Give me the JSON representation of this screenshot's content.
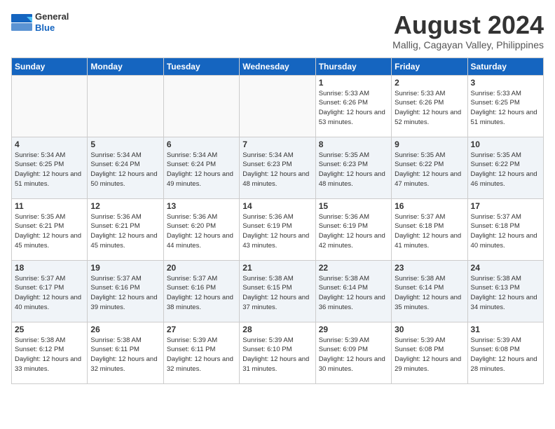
{
  "header": {
    "logo_line1": "General",
    "logo_line2": "Blue",
    "month_year": "August 2024",
    "location": "Mallig, Cagayan Valley, Philippines"
  },
  "weekdays": [
    "Sunday",
    "Monday",
    "Tuesday",
    "Wednesday",
    "Thursday",
    "Friday",
    "Saturday"
  ],
  "weeks": [
    [
      {
        "day": "",
        "info": ""
      },
      {
        "day": "",
        "info": ""
      },
      {
        "day": "",
        "info": ""
      },
      {
        "day": "",
        "info": ""
      },
      {
        "day": "1",
        "sunrise": "5:33 AM",
        "sunset": "6:26 PM",
        "daylight": "12 hours and 53 minutes."
      },
      {
        "day": "2",
        "sunrise": "5:33 AM",
        "sunset": "6:26 PM",
        "daylight": "12 hours and 52 minutes."
      },
      {
        "day": "3",
        "sunrise": "5:33 AM",
        "sunset": "6:25 PM",
        "daylight": "12 hours and 51 minutes."
      }
    ],
    [
      {
        "day": "4",
        "sunrise": "5:34 AM",
        "sunset": "6:25 PM",
        "daylight": "12 hours and 51 minutes."
      },
      {
        "day": "5",
        "sunrise": "5:34 AM",
        "sunset": "6:24 PM",
        "daylight": "12 hours and 50 minutes."
      },
      {
        "day": "6",
        "sunrise": "5:34 AM",
        "sunset": "6:24 PM",
        "daylight": "12 hours and 49 minutes."
      },
      {
        "day": "7",
        "sunrise": "5:34 AM",
        "sunset": "6:23 PM",
        "daylight": "12 hours and 48 minutes."
      },
      {
        "day": "8",
        "sunrise": "5:35 AM",
        "sunset": "6:23 PM",
        "daylight": "12 hours and 48 minutes."
      },
      {
        "day": "9",
        "sunrise": "5:35 AM",
        "sunset": "6:22 PM",
        "daylight": "12 hours and 47 minutes."
      },
      {
        "day": "10",
        "sunrise": "5:35 AM",
        "sunset": "6:22 PM",
        "daylight": "12 hours and 46 minutes."
      }
    ],
    [
      {
        "day": "11",
        "sunrise": "5:35 AM",
        "sunset": "6:21 PM",
        "daylight": "12 hours and 45 minutes."
      },
      {
        "day": "12",
        "sunrise": "5:36 AM",
        "sunset": "6:21 PM",
        "daylight": "12 hours and 45 minutes."
      },
      {
        "day": "13",
        "sunrise": "5:36 AM",
        "sunset": "6:20 PM",
        "daylight": "12 hours and 44 minutes."
      },
      {
        "day": "14",
        "sunrise": "5:36 AM",
        "sunset": "6:19 PM",
        "daylight": "12 hours and 43 minutes."
      },
      {
        "day": "15",
        "sunrise": "5:36 AM",
        "sunset": "6:19 PM",
        "daylight": "12 hours and 42 minutes."
      },
      {
        "day": "16",
        "sunrise": "5:37 AM",
        "sunset": "6:18 PM",
        "daylight": "12 hours and 41 minutes."
      },
      {
        "day": "17",
        "sunrise": "5:37 AM",
        "sunset": "6:18 PM",
        "daylight": "12 hours and 40 minutes."
      }
    ],
    [
      {
        "day": "18",
        "sunrise": "5:37 AM",
        "sunset": "6:17 PM",
        "daylight": "12 hours and 40 minutes."
      },
      {
        "day": "19",
        "sunrise": "5:37 AM",
        "sunset": "6:16 PM",
        "daylight": "12 hours and 39 minutes."
      },
      {
        "day": "20",
        "sunrise": "5:37 AM",
        "sunset": "6:16 PM",
        "daylight": "12 hours and 38 minutes."
      },
      {
        "day": "21",
        "sunrise": "5:38 AM",
        "sunset": "6:15 PM",
        "daylight": "12 hours and 37 minutes."
      },
      {
        "day": "22",
        "sunrise": "5:38 AM",
        "sunset": "6:14 PM",
        "daylight": "12 hours and 36 minutes."
      },
      {
        "day": "23",
        "sunrise": "5:38 AM",
        "sunset": "6:14 PM",
        "daylight": "12 hours and 35 minutes."
      },
      {
        "day": "24",
        "sunrise": "5:38 AM",
        "sunset": "6:13 PM",
        "daylight": "12 hours and 34 minutes."
      }
    ],
    [
      {
        "day": "25",
        "sunrise": "5:38 AM",
        "sunset": "6:12 PM",
        "daylight": "12 hours and 33 minutes."
      },
      {
        "day": "26",
        "sunrise": "5:38 AM",
        "sunset": "6:11 PM",
        "daylight": "12 hours and 32 minutes."
      },
      {
        "day": "27",
        "sunrise": "5:39 AM",
        "sunset": "6:11 PM",
        "daylight": "12 hours and 32 minutes."
      },
      {
        "day": "28",
        "sunrise": "5:39 AM",
        "sunset": "6:10 PM",
        "daylight": "12 hours and 31 minutes."
      },
      {
        "day": "29",
        "sunrise": "5:39 AM",
        "sunset": "6:09 PM",
        "daylight": "12 hours and 30 minutes."
      },
      {
        "day": "30",
        "sunrise": "5:39 AM",
        "sunset": "6:08 PM",
        "daylight": "12 hours and 29 minutes."
      },
      {
        "day": "31",
        "sunrise": "5:39 AM",
        "sunset": "6:08 PM",
        "daylight": "12 hours and 28 minutes."
      }
    ]
  ]
}
